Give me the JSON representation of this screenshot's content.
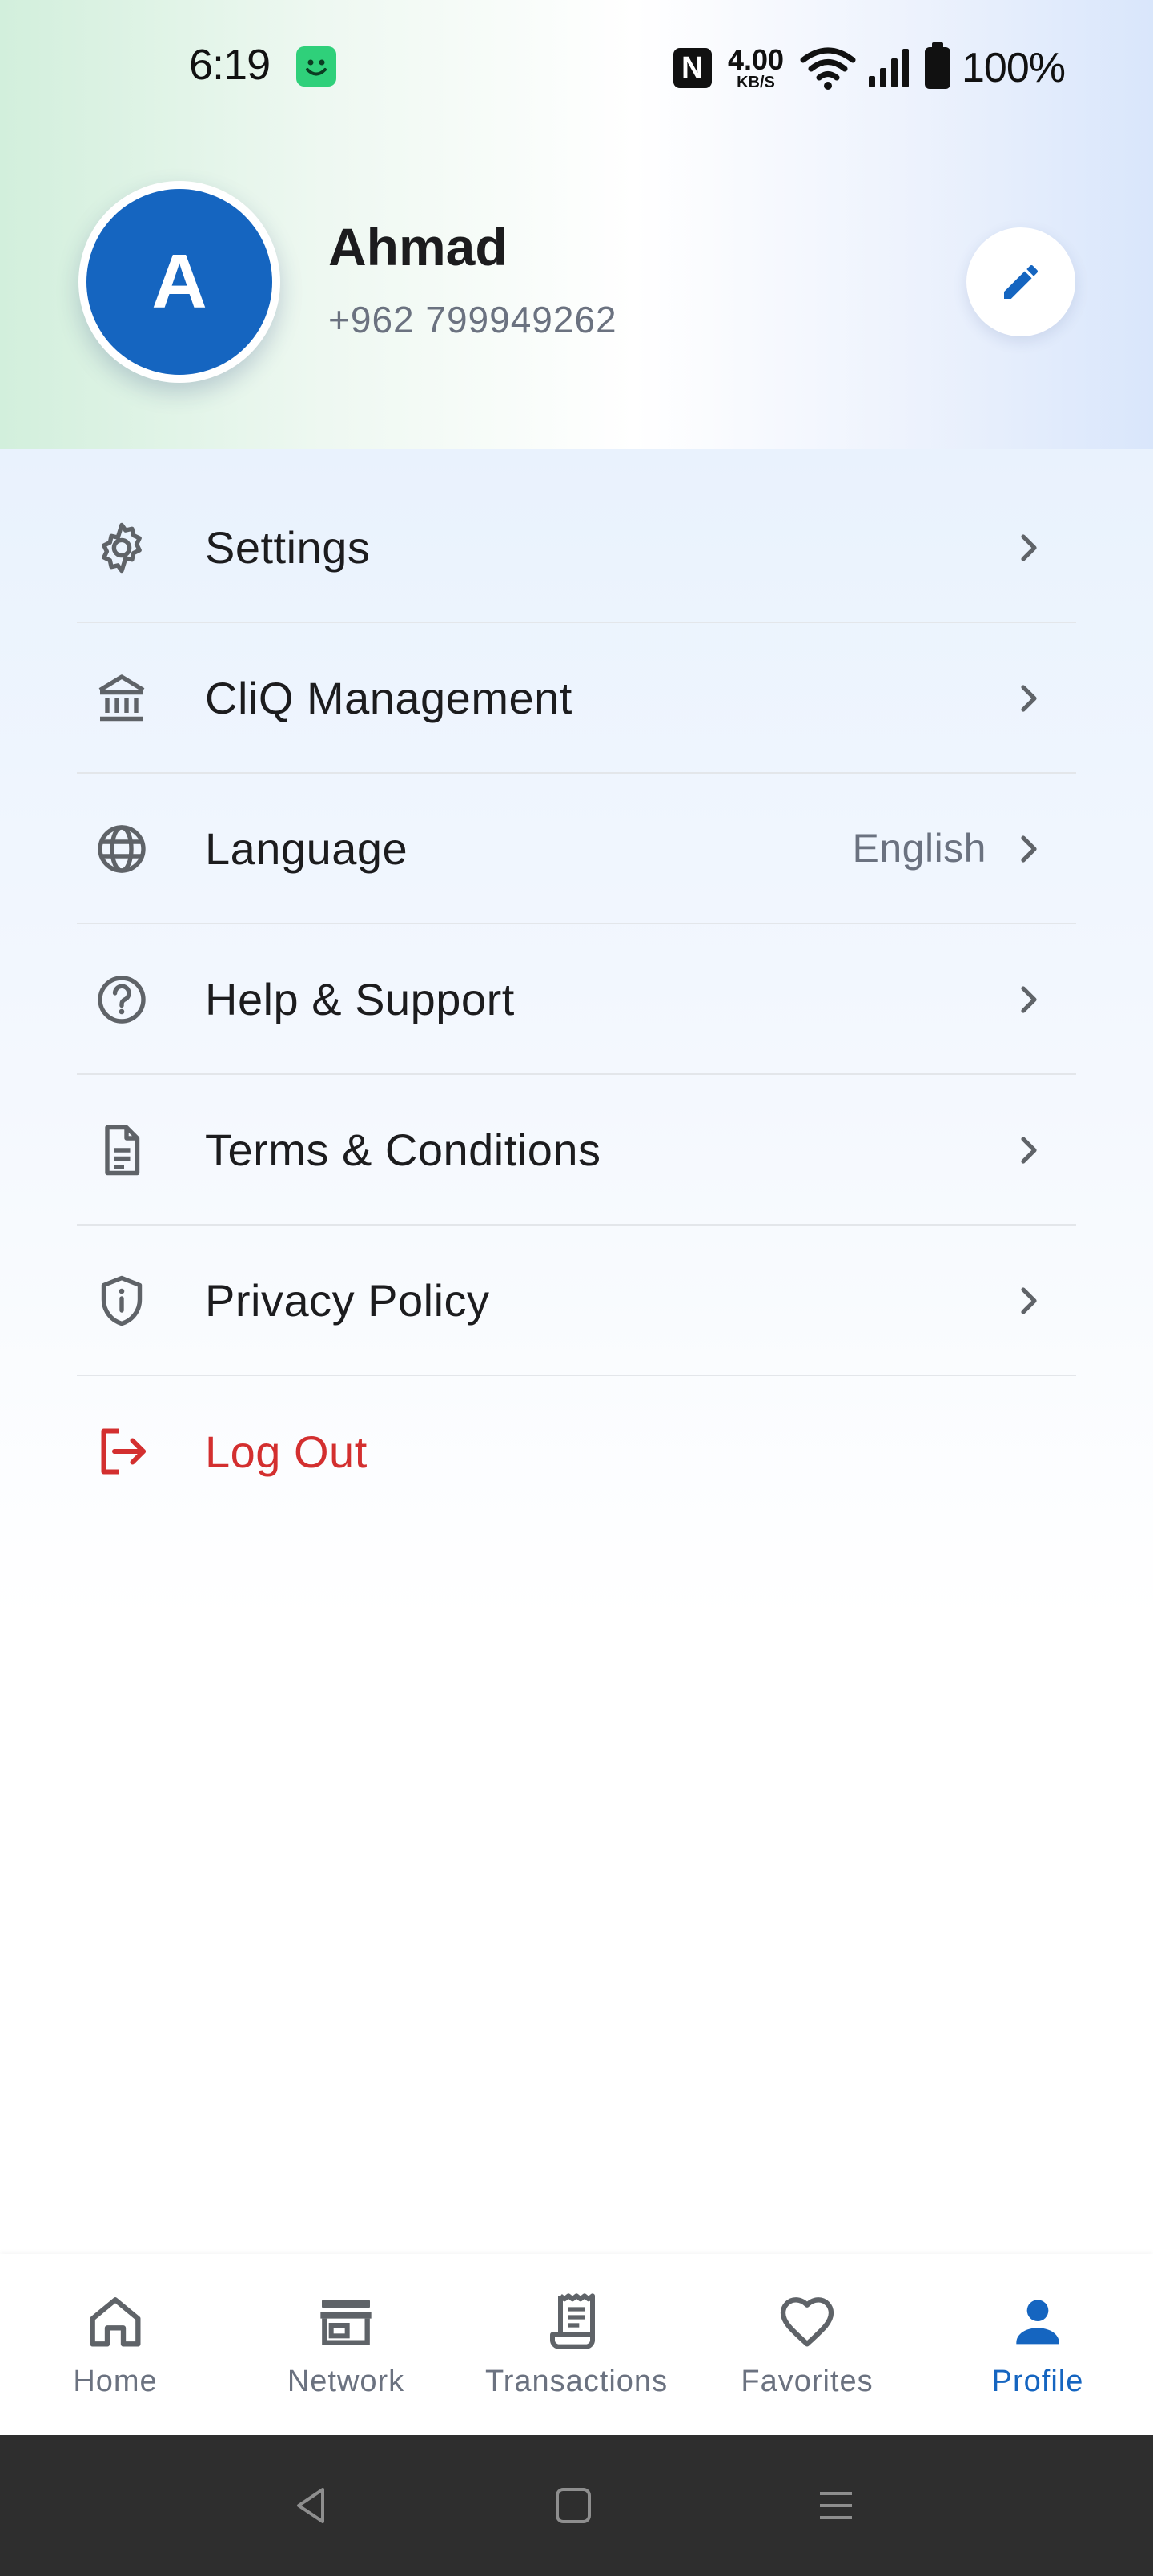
{
  "status_bar": {
    "time": "6:19",
    "speed_value": "4.00",
    "speed_unit": "KB/S",
    "battery": "100%"
  },
  "profile": {
    "avatar_initial": "A",
    "name": "Ahmad",
    "phone": "+962 799949262",
    "edit_icon": "pencil-icon"
  },
  "menu": {
    "items": [
      {
        "label": "Settings",
        "icon": "gear-icon"
      },
      {
        "label": "CliQ Management",
        "icon": "bank-icon"
      },
      {
        "label": "Language",
        "value": "English",
        "icon": "globe-icon"
      },
      {
        "label": "Help & Support",
        "icon": "help-circle-icon"
      },
      {
        "label": "Terms & Conditions",
        "icon": "document-icon"
      },
      {
        "label": "Privacy Policy",
        "icon": "shield-icon"
      }
    ],
    "logout": {
      "label": "Log Out",
      "icon": "logout-icon"
    }
  },
  "bottom_nav": {
    "items": [
      {
        "label": "Home",
        "icon": "home-icon"
      },
      {
        "label": "Network",
        "icon": "store-icon"
      },
      {
        "label": "Transactions",
        "icon": "receipt-icon"
      },
      {
        "label": "Favorites",
        "icon": "heart-icon"
      },
      {
        "label": "Profile",
        "icon": "person-icon",
        "active": true
      }
    ]
  },
  "colors": {
    "primary": "#1565c0",
    "danger": "#d32f2f",
    "icon_gray": "#5f6368",
    "text_secondary": "#6b7280"
  }
}
